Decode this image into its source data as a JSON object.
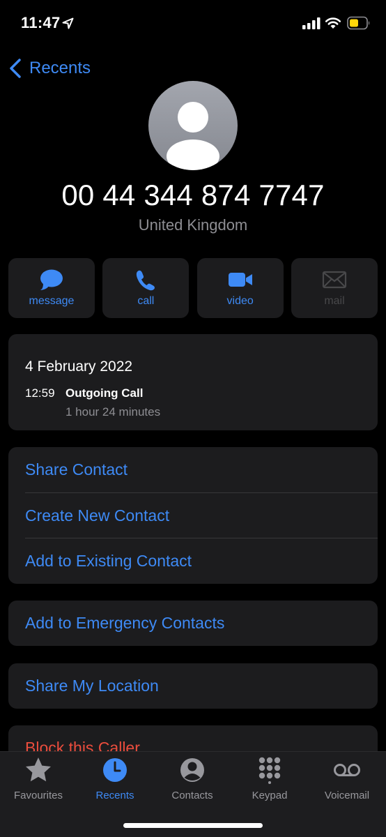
{
  "status_bar": {
    "time": "11:47",
    "icons": [
      "location-arrow-icon",
      "signal-icon",
      "wifi-icon",
      "battery-icon"
    ],
    "battery_color": "#ffd60a"
  },
  "nav": {
    "back_label": "Recents"
  },
  "contact": {
    "phone_number": "00 44 344 874 7747",
    "country": "United Kingdom"
  },
  "actions": [
    {
      "label": "message",
      "icon": "message-bubble-icon",
      "enabled": true
    },
    {
      "label": "call",
      "icon": "phone-icon",
      "enabled": true
    },
    {
      "label": "video",
      "icon": "video-camera-icon",
      "enabled": true
    },
    {
      "label": "mail",
      "icon": "envelope-icon",
      "enabled": false
    }
  ],
  "call_history": {
    "date": "4 February 2022",
    "entries": [
      {
        "time": "12:59",
        "type": "Outgoing Call",
        "duration": "1 hour 24 minutes"
      }
    ]
  },
  "menu": {
    "contact_options": [
      "Share Contact",
      "Create New Contact",
      "Add to Existing Contact"
    ],
    "emergency": "Add to Emergency Contacts",
    "share_location": "Share My Location",
    "block": "Block this Caller"
  },
  "tab_bar": {
    "tabs": [
      {
        "label": "Favourites",
        "icon": "star-icon"
      },
      {
        "label": "Recents",
        "icon": "clock-icon"
      },
      {
        "label": "Contacts",
        "icon": "person-circle-icon"
      },
      {
        "label": "Keypad",
        "icon": "keypad-icon"
      },
      {
        "label": "Voicemail",
        "icon": "voicemail-icon"
      }
    ],
    "active": "Recents"
  },
  "colors": {
    "accent": "#3e8af5",
    "destructive": "#eb4d3d",
    "card_bg": "#1c1c1e",
    "secondary_text": "#8e8e93"
  }
}
